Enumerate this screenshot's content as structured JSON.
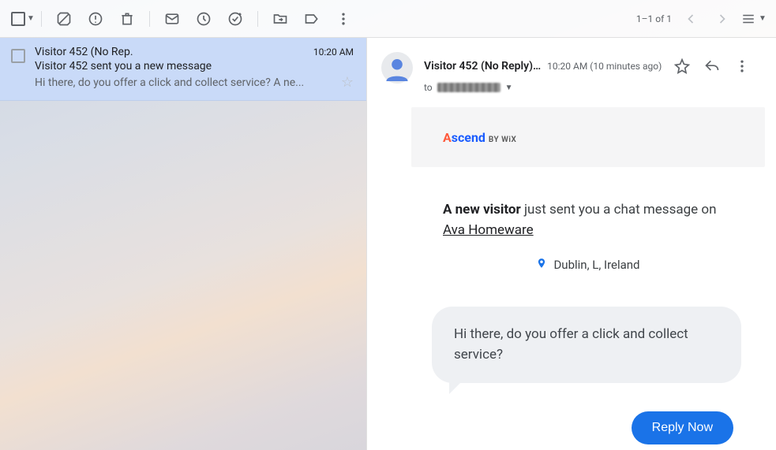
{
  "toolbar": {
    "page_count": "1–1 of 1"
  },
  "list": {
    "items": [
      {
        "sender": "Visitor 452 (No Rep.",
        "time": "10:20 AM",
        "subject": "Visitor 452 sent you a new message",
        "snippet": "Hi there, do you offer a click and collect service? A ne..."
      }
    ]
  },
  "message": {
    "from": "Visitor 452 (No Reply)…",
    "timestamp": "10:20 AM (10 minutes ago)",
    "to_prefix": "to",
    "brand_bywix": "BY WiX",
    "notice_strong": "A new visitor",
    "notice_rest": " just sent you a chat message on ",
    "site_name": "Ava Homeware",
    "location": "Dublin, L, Ireland",
    "chat_text": "Hi there, do you offer a click and collect service?",
    "reply_label": "Reply Now"
  }
}
